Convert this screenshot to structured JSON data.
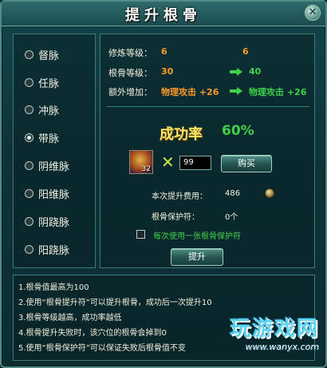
{
  "window": {
    "title": "提升根骨",
    "close_icon": "✕"
  },
  "meridians": {
    "selected_index": 3,
    "items": [
      {
        "label": "督脉"
      },
      {
        "label": "任脉"
      },
      {
        "label": "冲脉"
      },
      {
        "label": "带脉"
      },
      {
        "label": "阴维脉"
      },
      {
        "label": "阳维脉"
      },
      {
        "label": "阴跷脉"
      },
      {
        "label": "阳跷脉"
      }
    ]
  },
  "stats": {
    "cultivation_label": "修炼等级：",
    "cultivation_current": "6",
    "cultivation_next": "6",
    "bone_label": "根骨等级：",
    "bone_current": "30",
    "bone_next": "40",
    "extra_label": "额外增加：",
    "extra_current": "物理攻击 +26",
    "extra_next": "物理攻击 +26"
  },
  "success": {
    "label": "成功率",
    "rate": "60%"
  },
  "item": {
    "count": "32",
    "quantity": "99",
    "times_symbol": "✕"
  },
  "buttons": {
    "buy": "购买",
    "promote": "提升"
  },
  "cost": {
    "label": "本次提升费用：",
    "value": "486"
  },
  "protect": {
    "label": "根骨保护符：",
    "value": "0个"
  },
  "option": {
    "label": "每次使用一张根骨保护符"
  },
  "notes": [
    "1.根骨值最高为100",
    "2.使用“根骨提升符”可以提升根骨，成功后一次提升10",
    "3.根骨等级越高，成功率越低",
    "4.根骨提升失败时，该穴位的根骨会掉到0",
    "5.使用“根骨保护符”可以保证失败后根骨值不变"
  ],
  "watermark": {
    "main": "玩游戏网",
    "url": "www.wanyx.com"
  },
  "colors": {
    "accent_orange": "#ff9a2a",
    "accent_green": "#3fd24a",
    "gold": "#ffe566"
  }
}
